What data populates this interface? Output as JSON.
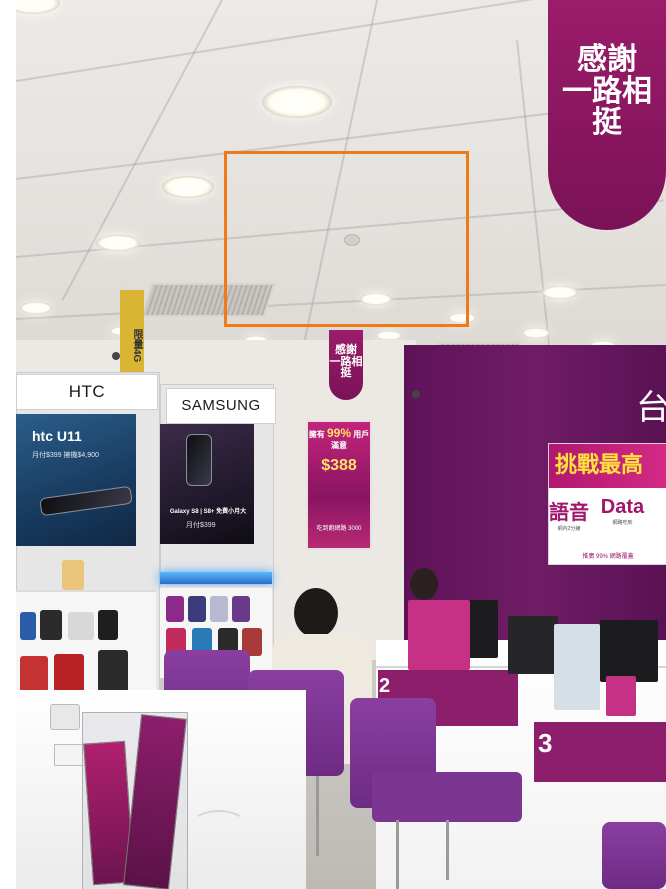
{
  "store": {
    "ceiling_banner": "感謝\n一路相挺",
    "small_banner": "感謝\n一路相挺",
    "yellow_banner": "限量4G",
    "brand_htc": "HTC",
    "brand_samsung": "SAMSUNG",
    "htc_screen_title": "htc U11",
    "htc_screen_sub": "月付$399 擁機$4,900",
    "samsung_screen_title": "Galaxy S8 | S8+ 免費小月大",
    "samsung_screen_sub": "月付$399",
    "poster_top": "擁有",
    "poster_top_num": "99%",
    "poster_top_suffix": "用戶滿意",
    "poster_mid": "$388",
    "poster_bot": "吃到飽網路 3000",
    "sign_headline": "挑戰最高",
    "sign_voice": "語音",
    "sign_data": "Data",
    "sign_voice_sub": "網內2分鐘",
    "sign_data_sub": "網路吃到",
    "sign_bottom": "推廣 99% 網路覆蓋",
    "counter_2": "2",
    "counter_3": "3",
    "purple_wall_text": "台",
    "highlight_color": "#f07a17",
    "brand_purple": "#8d1e6c"
  }
}
